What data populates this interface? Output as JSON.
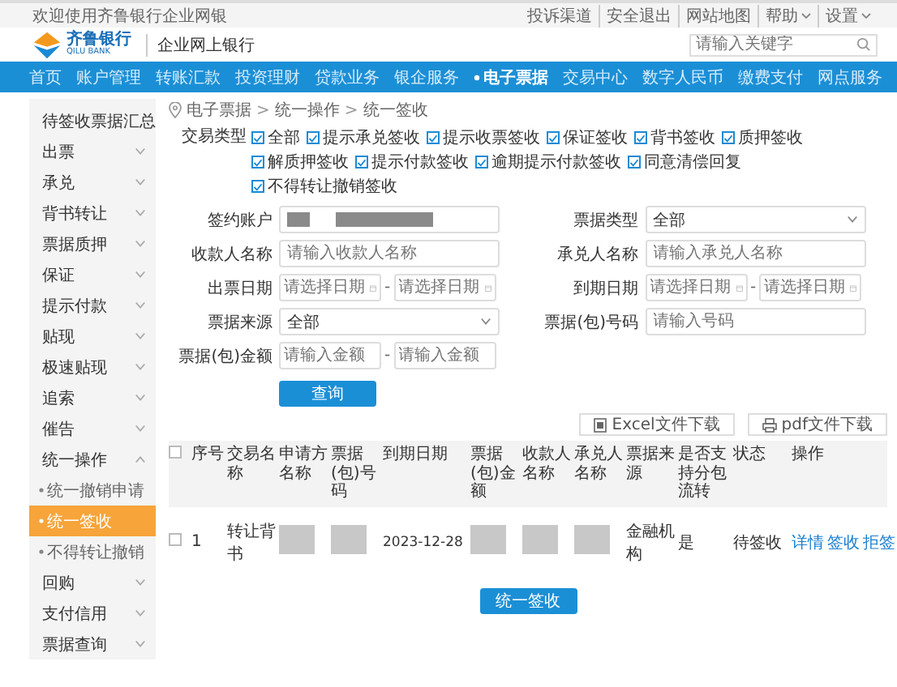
{
  "top_bar": {
    "welcome": "欢迎使用齐鲁银行企业网银",
    "links": [
      {
        "label": "投诉渠道",
        "kind": "link"
      },
      {
        "label": "安全退出",
        "kind": "link"
      },
      {
        "label": "网站地图",
        "kind": "link"
      },
      {
        "label": "帮助",
        "kind": "menu"
      },
      {
        "label": "设置",
        "kind": "menu"
      }
    ]
  },
  "header": {
    "logo_name": "齐鲁银行",
    "logo_sub": "QILU BANK",
    "product": "企业网上银行",
    "search": {
      "placeholder": "请输入关键字"
    }
  },
  "nav": [
    {
      "label": "首页",
      "selected": false
    },
    {
      "label": "账户管理",
      "selected": false
    },
    {
      "label": "转账汇款",
      "selected": false
    },
    {
      "label": "投资理财",
      "selected": false
    },
    {
      "label": "贷款业务",
      "selected": false
    },
    {
      "label": "银企服务",
      "selected": false
    },
    {
      "label": "电子票据",
      "selected": true
    },
    {
      "label": "交易中心",
      "selected": false
    },
    {
      "label": "数字人民币",
      "selected": false
    },
    {
      "label": "缴费支付",
      "selected": false
    },
    {
      "label": "网点服务",
      "selected": false
    }
  ],
  "sidebar": [
    {
      "label": "待签收票据汇总",
      "kind": "link"
    },
    {
      "label": "出票",
      "kind": "group",
      "expanded": false
    },
    {
      "label": "承兑",
      "kind": "group",
      "expanded": false
    },
    {
      "label": "背书转让",
      "kind": "group",
      "expanded": false
    },
    {
      "label": "票据质押",
      "kind": "group",
      "expanded": false
    },
    {
      "label": "保证",
      "kind": "group",
      "expanded": false
    },
    {
      "label": "提示付款",
      "kind": "group",
      "expanded": false
    },
    {
      "label": "贴现",
      "kind": "group",
      "expanded": false
    },
    {
      "label": "极速贴现",
      "kind": "group",
      "expanded": false
    },
    {
      "label": "追索",
      "kind": "group",
      "expanded": false
    },
    {
      "label": "催告",
      "kind": "group",
      "expanded": false
    },
    {
      "label": "统一操作",
      "kind": "group",
      "expanded": true,
      "children": [
        {
          "label": "统一撤销申请",
          "selected": false
        },
        {
          "label": "统一签收",
          "selected": true
        },
        {
          "label": "不得转让撤销",
          "selected": false
        }
      ]
    },
    {
      "label": "回购",
      "kind": "group",
      "expanded": false
    },
    {
      "label": "支付信用",
      "kind": "group",
      "expanded": false
    },
    {
      "label": "票据查询",
      "kind": "group",
      "expanded": false
    }
  ],
  "breadcrumb": [
    "电子票据",
    "统一操作",
    "统一签收"
  ],
  "breadcrumb_separator": ">",
  "trade_type": {
    "label": "交易类型",
    "options": [
      {
        "label": "全部",
        "checked": true
      },
      {
        "label": "提示承兑签收",
        "checked": true
      },
      {
        "label": "提示收票签收",
        "checked": true
      },
      {
        "label": "保证签收",
        "checked": true
      },
      {
        "label": "背书签收",
        "checked": true
      },
      {
        "label": "质押签收",
        "checked": true
      },
      {
        "label": "解质押签收",
        "checked": true
      },
      {
        "label": "提示付款签收",
        "checked": true
      },
      {
        "label": "逾期提示付款签收",
        "checked": true
      },
      {
        "label": "同意清偿回复",
        "checked": true
      },
      {
        "label": "不得转让撤销签收",
        "checked": true
      }
    ]
  },
  "form": [
    {
      "kind": "masked",
      "label": "签约账户"
    },
    {
      "kind": "select",
      "label": "票据类型",
      "value": "全部"
    },
    {
      "kind": "text",
      "label": "收款人名称",
      "placeholder": "请输入收款人名称"
    },
    {
      "kind": "text",
      "label": "承兑人名称",
      "placeholder": "请输入承兑人名称"
    },
    {
      "kind": "date_range",
      "label": "出票日期",
      "placeholder": "请选择日期",
      "placeholder_end": "请选择日期",
      "separator": "-"
    },
    {
      "kind": "date_range",
      "label": "到期日期",
      "placeholder": "请选择日期",
      "placeholder_end": "请选择日期",
      "separator": "-"
    },
    {
      "kind": "select",
      "label": "票据来源",
      "value": "全部"
    },
    {
      "kind": "text",
      "label": "票据(包)号码",
      "placeholder": "请输入号码"
    },
    {
      "kind": "range",
      "label": "票据(包)金额",
      "placeholder": "请输入金额",
      "placeholder_end": "请输入金额",
      "separator": "-"
    }
  ],
  "query_button": "查询",
  "downloads": [
    {
      "label": "Excel文件下载",
      "kind": "excel"
    },
    {
      "label": "pdf文件下载",
      "kind": "pdf"
    }
  ],
  "table": {
    "all_checked": false,
    "columns": [
      "序号",
      "交易名称",
      "申请方名称",
      "票据(包)号码",
      "到期日期",
      "票据(包)金额",
      "收款人名称",
      "承兑人名称",
      "票据来源",
      "是否支持分包流转",
      "状态",
      "操作"
    ],
    "rows": [
      {
        "checked": false,
        "cells": [
          {
            "kind": "text",
            "text": "1"
          },
          {
            "kind": "text",
            "text": "转让背书"
          },
          {
            "kind": "masked"
          },
          {
            "kind": "masked"
          },
          {
            "kind": "text",
            "text": "2023-12-28"
          },
          {
            "kind": "masked"
          },
          {
            "kind": "masked"
          },
          {
            "kind": "masked"
          },
          {
            "kind": "text",
            "text": "金融机构"
          },
          {
            "kind": "text",
            "text": "是"
          },
          {
            "kind": "text",
            "text": "待签收"
          },
          {
            "kind": "actions",
            "actions": [
              "详情",
              "签收",
              "拒签"
            ]
          }
        ]
      }
    ]
  },
  "submit_button": "统一签收"
}
